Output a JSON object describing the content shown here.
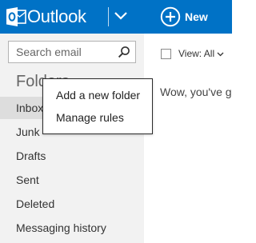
{
  "header": {
    "app_title": "Outlook",
    "new_label": "New",
    "brand_color": "#0072c6",
    "logo_icon": "outlook-logo-icon",
    "switcher_icon": "chevron-down-icon",
    "new_icon": "plus-circle-icon"
  },
  "search": {
    "placeholder": "Search email",
    "value": "",
    "icon": "search-icon"
  },
  "sidebar": {
    "heading": "Folders",
    "items": [
      {
        "label": "Inbox",
        "selected": true
      },
      {
        "label": "Junk",
        "selected": false
      },
      {
        "label": "Drafts",
        "selected": false
      },
      {
        "label": "Sent",
        "selected": false
      },
      {
        "label": "Deleted",
        "selected": false
      },
      {
        "label": "Messaging history",
        "selected": false
      }
    ]
  },
  "context_menu": {
    "items": [
      {
        "label": "Add a new folder"
      },
      {
        "label": "Manage rules"
      }
    ]
  },
  "main": {
    "view_label": "View: All",
    "view_icon": "chevron-down-icon",
    "message_text": "Wow, you've g"
  }
}
